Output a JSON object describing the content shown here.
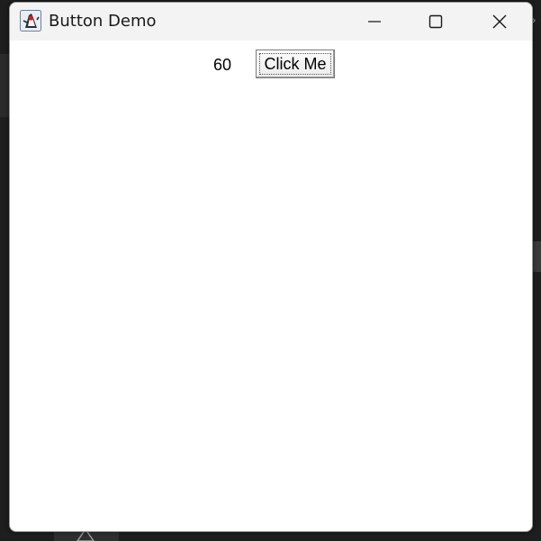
{
  "window": {
    "title": "Button Demo",
    "icon": "java-duke-icon",
    "controls": {
      "minimize_icon": "minimize-icon",
      "maximize_icon": "maximize-icon",
      "close_icon": "close-icon"
    }
  },
  "content": {
    "counter_value": "60",
    "button_label": "Click Me"
  },
  "colors": {
    "titlebar_bg": "#f3f3f3",
    "content_bg": "#ffffff",
    "desktop_bg": "#1e1e1e"
  }
}
